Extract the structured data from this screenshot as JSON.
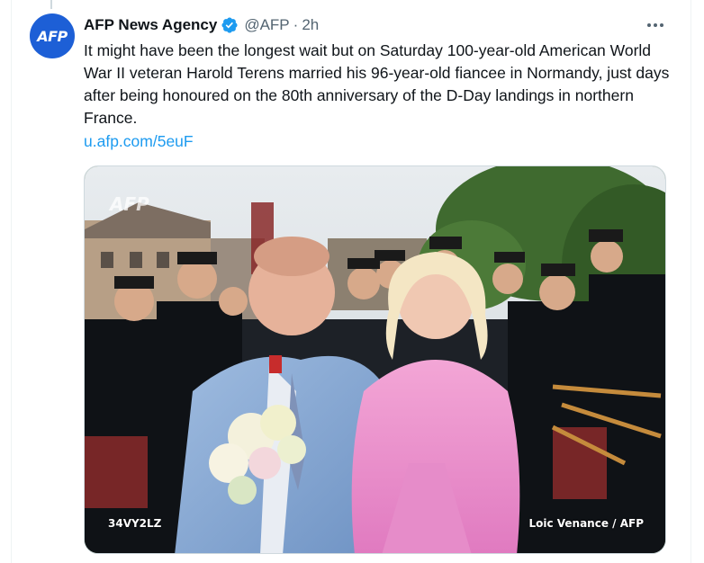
{
  "tweet": {
    "avatar_text": "AFP",
    "display_name": "AFP News Agency",
    "handle": "@AFP",
    "separator": "·",
    "time": "2h",
    "more_icon": "more-horizontal-icon",
    "text": "It might have been the longest wait but on Saturday 100-year-old American World War II veteran Harold Terens married his 96-year-old fiancee in Normandy, just days after being honoured on the 80th anniversary of the D-Day landings in northern France.",
    "link": "u.afp.com/5euF"
  },
  "media": {
    "watermark": "AFP",
    "code": "34VY2LZ",
    "credit": "Loic Venance / AFP"
  },
  "colors": {
    "verified": "#1d9bf0",
    "link": "#1d9bf0",
    "avatar_bg": "#1d5fd6",
    "secondary_text": "#536471"
  }
}
